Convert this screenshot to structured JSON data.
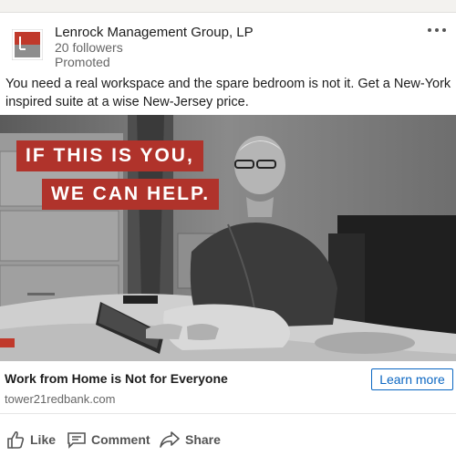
{
  "post": {
    "company": "Lenrock Management Group, LP",
    "followers": "20 followers",
    "promoted": "Promoted",
    "body": "You need a real workspace and the spare bedroom is not it. Get a New-York inspired suite at a wise New-Jersey price."
  },
  "hero": {
    "banner_line1": "IF THIS IS YOU,",
    "banner_line2": "WE CAN HELP."
  },
  "link": {
    "title": "Work from Home is Not for Everyone",
    "domain": "tower21redbank.com",
    "cta": "Learn more"
  },
  "actions": {
    "like": "Like",
    "comment": "Comment",
    "share": "Share"
  },
  "colors": {
    "accent": "#0a66c2",
    "banner": "#b0332b"
  }
}
